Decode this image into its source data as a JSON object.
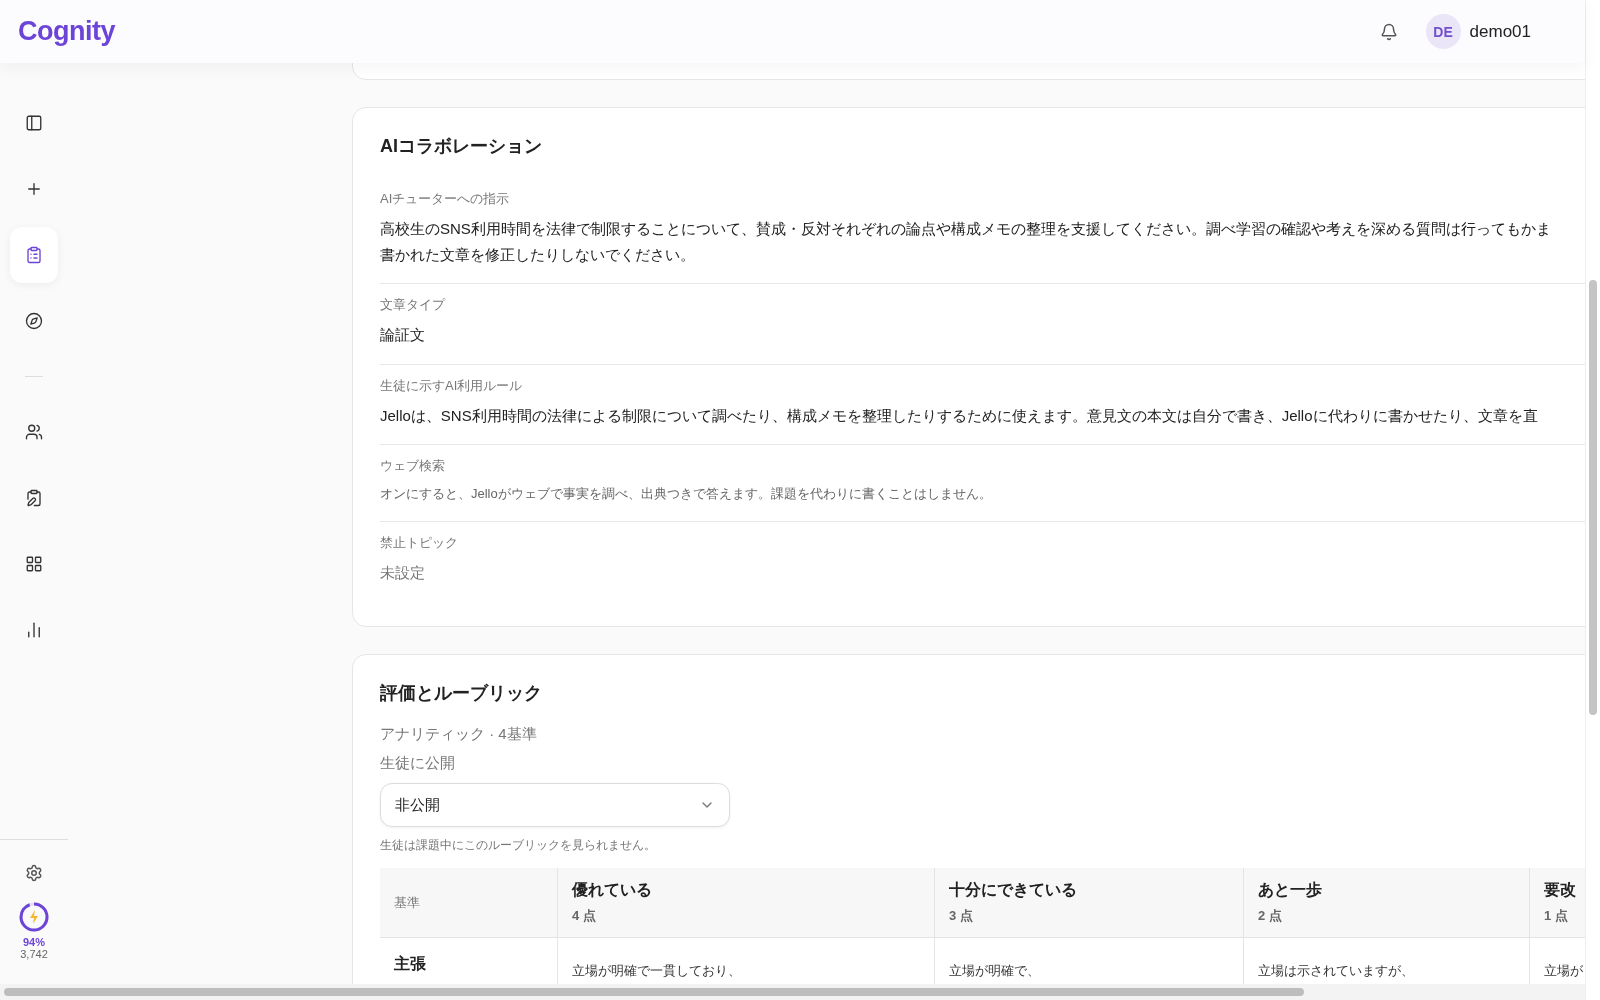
{
  "header": {
    "logo": "Cognity",
    "avatar": "DE",
    "user": "demo01"
  },
  "sidebar": {
    "items": [
      {
        "kind": "panel",
        "selected": false
      },
      {
        "kind": "plus",
        "selected": false
      },
      {
        "kind": "clipboard",
        "selected": true
      },
      {
        "kind": "compass",
        "selected": false
      },
      {
        "kind": "divider"
      },
      {
        "kind": "people",
        "selected": false
      },
      {
        "kind": "clipboard-pen",
        "selected": false
      },
      {
        "kind": "grid",
        "selected": false
      },
      {
        "kind": "chart",
        "selected": false
      }
    ],
    "usage": {
      "level": 0.94,
      "percent": "94%",
      "count": "3,742"
    }
  },
  "ai_section": {
    "title": "AIコラボレーション",
    "fields": [
      {
        "label": "AIチューターへの指示",
        "lines": [
          "高校生のSNS利用時間を法律で制限することについて、賛成・反対それぞれの論点や構成メモの整理を支援してください。調べ学習の確認や考えを深める質問は行ってもかま",
          "書かれた文章を修正したりしないでください。"
        ],
        "kind": "text"
      },
      {
        "label": "文章タイプ",
        "value": "論証文",
        "kind": "text"
      },
      {
        "label": "生徒に示すAI利用ルール",
        "value": "Jelloは、SNS利用時間の法律による制限について調べたり、構成メモを整理したりするために使えます。意見文の本文は自分で書き、Jelloに代わりに書かせたり、文章を直",
        "kind": "text"
      },
      {
        "label": "ウェブ検索",
        "value": "オンにすると、Jelloがウェブで事実を調べ、出典つきで答えます。課題を代わりに書くことはしません。",
        "kind": "note"
      },
      {
        "label": "禁止トピック",
        "value": "未設定",
        "kind": "muted"
      }
    ]
  },
  "rubric_section": {
    "title": "評価とルーブリック",
    "summary": "アナリティック · 4基準",
    "visibility_label": "生徒に公開",
    "visibility": {
      "value": "非公開"
    },
    "note": "生徒は課題中にこのルーブリックを見られません。",
    "table": {
      "corner": "基準",
      "columns": [
        {
          "name": "優れている",
          "points": "4 点"
        },
        {
          "name": "十分にできている",
          "points": "3 点"
        },
        {
          "name": "あと一歩",
          "points": "2 点"
        },
        {
          "name": "要改",
          "points": "1 点"
        }
      ],
      "rows": [
        {
          "criterion": "主張",
          "cells": [
            "立場が明確で一貫しており、",
            "立場が明確で、",
            "立場は示されていますが、",
            "立場が"
          ]
        }
      ]
    }
  }
}
